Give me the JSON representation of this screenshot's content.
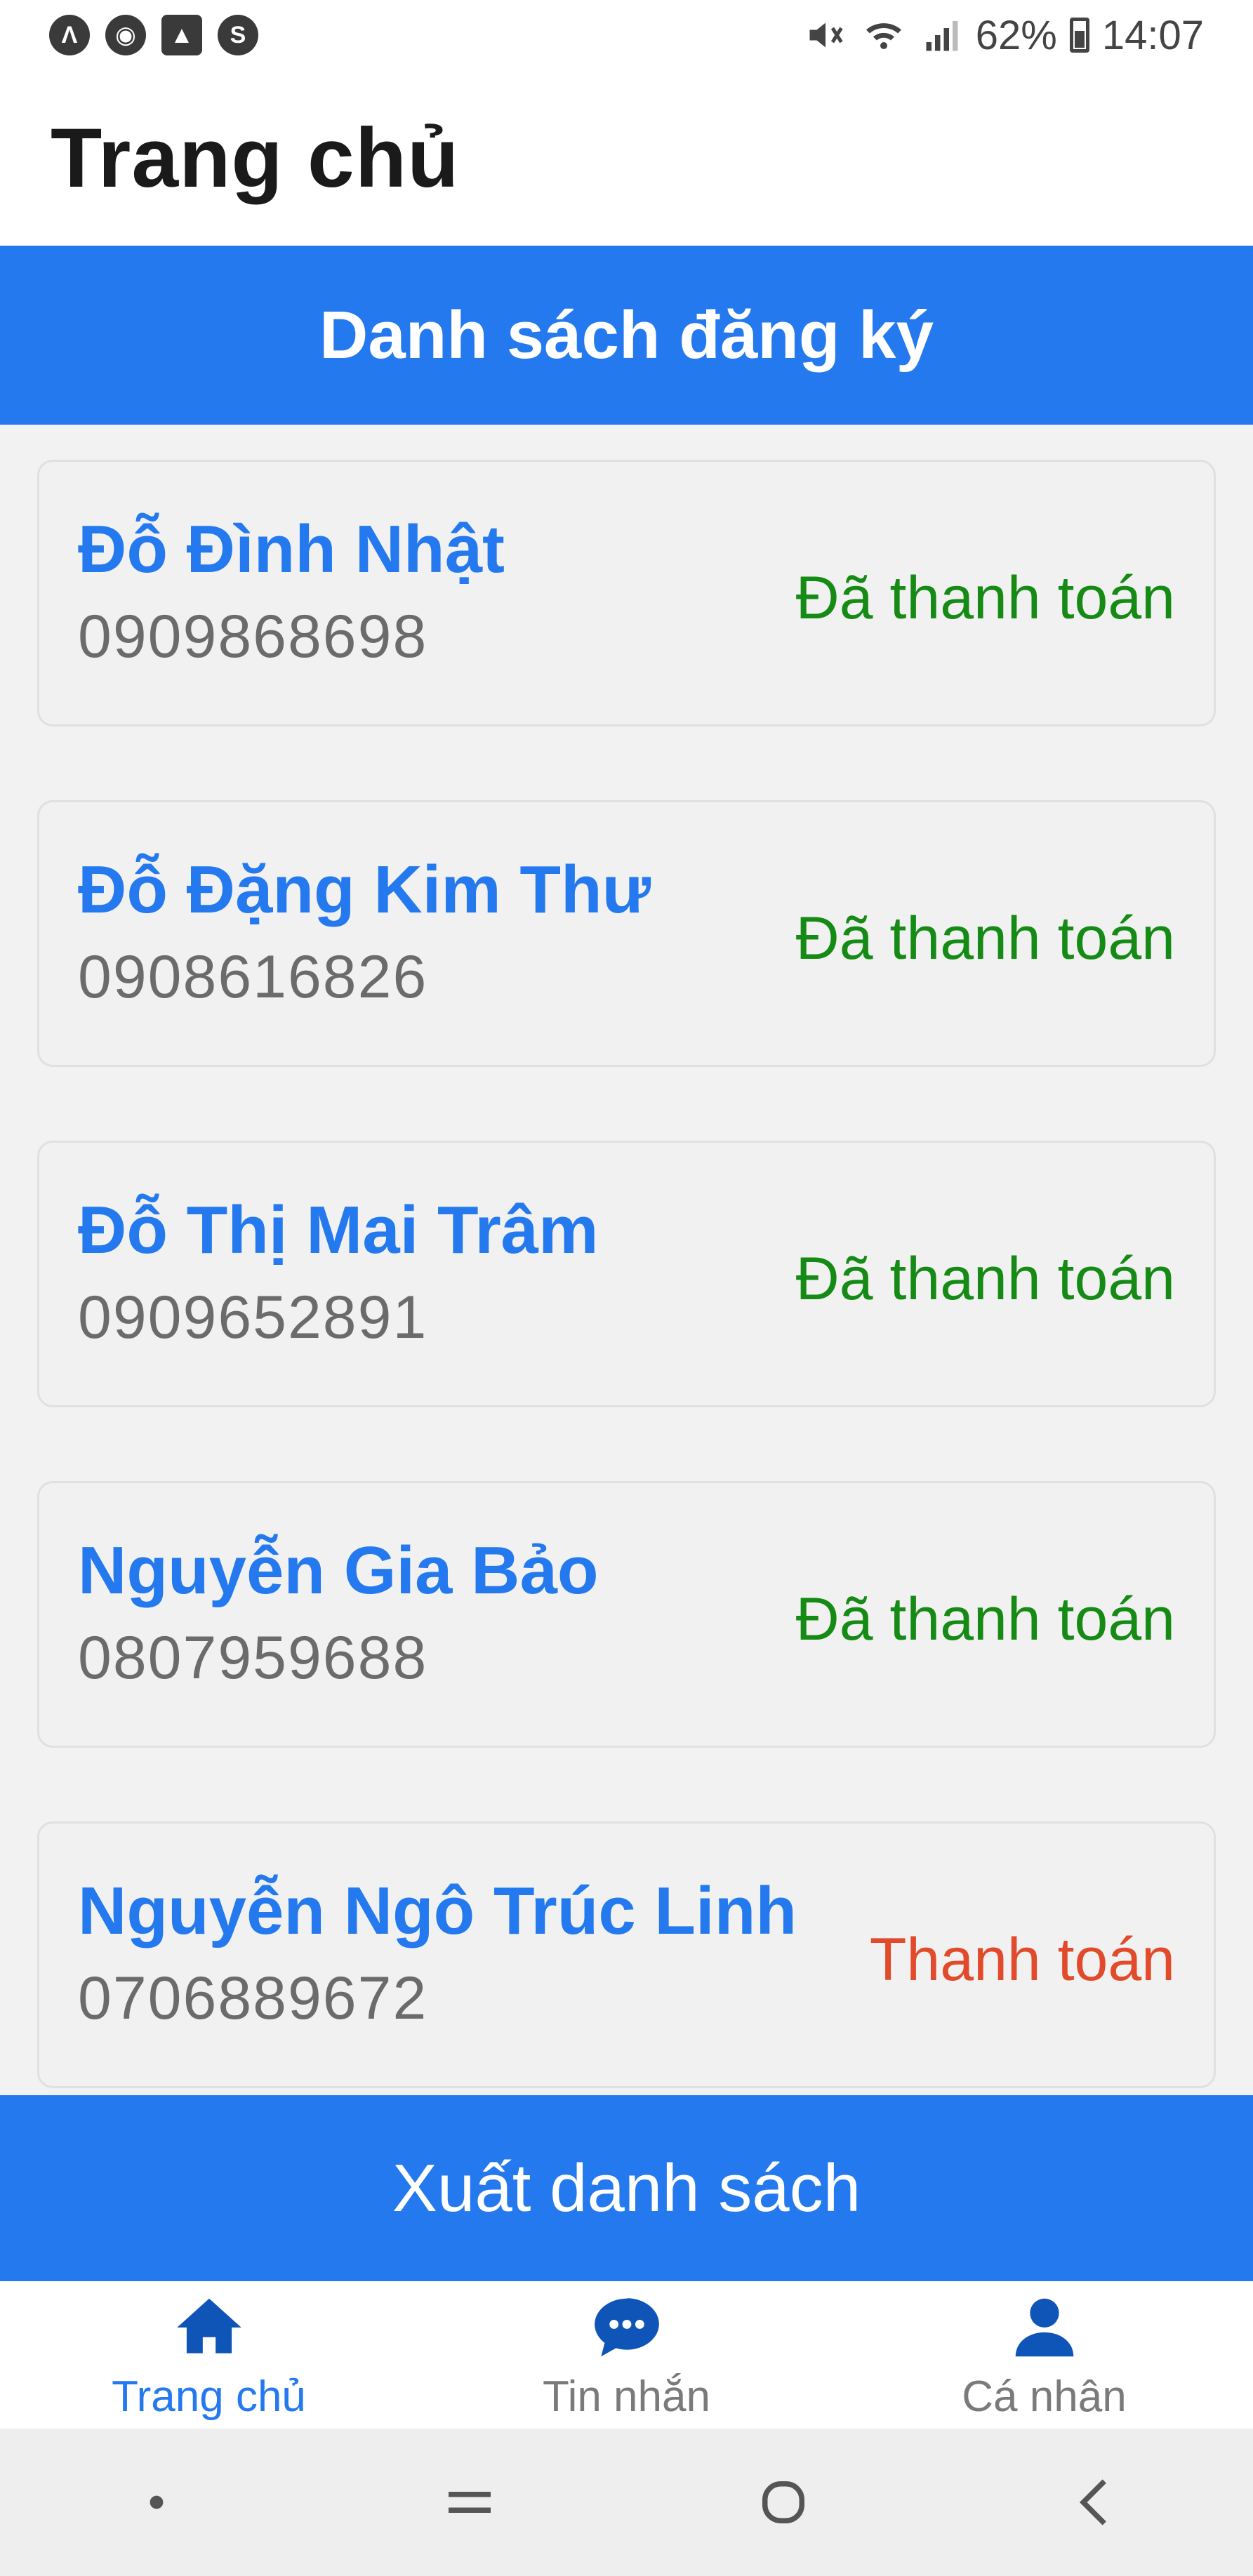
{
  "status_bar": {
    "battery": "62%",
    "time": "14:07",
    "left_icons": [
      "app-icon-a",
      "account-icon",
      "image-icon",
      "sync-icon"
    ]
  },
  "header": {
    "title": "Trang chủ"
  },
  "list": {
    "title": "Danh sách đăng ký",
    "items": [
      {
        "name": "Đỗ Đình Nhật",
        "phone": "0909868698",
        "status": "Đã thanh toán",
        "paid": true
      },
      {
        "name": "Đỗ Đặng Kim Thư",
        "phone": "0908616826",
        "status": "Đã thanh toán",
        "paid": true
      },
      {
        "name": "Đỗ Thị Mai Trâm",
        "phone": "0909652891",
        "status": "Đã thanh toán",
        "paid": true
      },
      {
        "name": "Nguyễn Gia Bảo",
        "phone": "0807959688",
        "status": "Đã thanh toán",
        "paid": true
      },
      {
        "name": "Nguyễn Ngô Trúc Linh",
        "phone": "0706889672",
        "status": "Thanh toán",
        "paid": false
      }
    ]
  },
  "export_button": {
    "label": "Xuất danh sách"
  },
  "tabs": [
    {
      "label": "Trang chủ",
      "icon": "home-icon",
      "active": true
    },
    {
      "label": "Tin nhắn",
      "icon": "chat-icon",
      "active": false
    },
    {
      "label": "Cá nhân",
      "icon": "person-icon",
      "active": false
    }
  ],
  "colors": {
    "primary": "#2479ef",
    "paid": "#158a15",
    "unpaid": "#e14a2a",
    "inactive_tab": "#7a7a7a"
  }
}
